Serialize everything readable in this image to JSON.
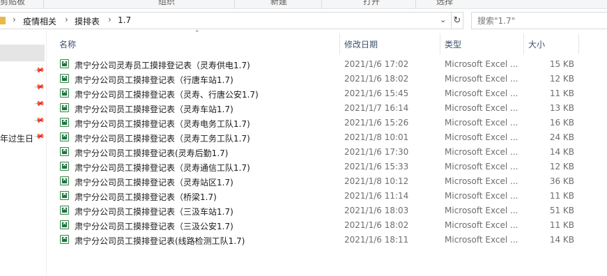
{
  "ribbon": {
    "groups": [
      "剪贴板",
      "组织",
      "新建",
      "打开",
      "选择"
    ]
  },
  "address": {
    "crumbs": [
      "疫情相关",
      "摸排表",
      "1.7"
    ],
    "separator": "›",
    "dropdown_icon": "chevron-down-icon",
    "refresh_icon": "refresh-icon"
  },
  "search": {
    "placeholder": "搜索\"1.7\""
  },
  "nav": {
    "partial_item": "年过生日"
  },
  "columns": {
    "name": "名称",
    "date": "修改日期",
    "type": "类型",
    "size": "大小"
  },
  "files": [
    {
      "name": "肃宁分公司灵寿员工摸排登记表（灵寿供电1.7)",
      "date": "2021/1/6 17:02",
      "type": "Microsoft Excel ...",
      "size": "15 KB"
    },
    {
      "name": "肃宁分公司员工摸排登记表（行唐车站1.7)",
      "date": "2021/1/6 18:02",
      "type": "Microsoft Excel ...",
      "size": "12 KB"
    },
    {
      "name": "肃宁分公司员工摸排登记表（灵寿、行唐公安1.7)",
      "date": "2021/1/6 15:45",
      "type": "Microsoft Excel ...",
      "size": "11 KB"
    },
    {
      "name": "肃宁分公司员工摸排登记表（灵寿车站1.7)",
      "date": "2021/1/7 16:14",
      "type": "Microsoft Excel ...",
      "size": "13 KB"
    },
    {
      "name": "肃宁分公司员工摸排登记表（灵寿电务工队1.7)",
      "date": "2021/1/6 15:26",
      "type": "Microsoft Excel ...",
      "size": "16 KB"
    },
    {
      "name": "肃宁分公司员工摸排登记表（灵寿工务工队1.7)",
      "date": "2021/1/8 10:01",
      "type": "Microsoft Excel ...",
      "size": "24 KB"
    },
    {
      "name": "肃宁分公司员工摸排登记表(灵寿后勤1.7)",
      "date": "2021/1/6 17:30",
      "type": "Microsoft Excel ...",
      "size": "14 KB"
    },
    {
      "name": "肃宁分公司员工摸排登记表（灵寿通信工队1.7)",
      "date": "2021/1/6 15:33",
      "type": "Microsoft Excel ...",
      "size": "12 KB"
    },
    {
      "name": "肃宁分公司员工摸排登记表（灵寿站区1.7)",
      "date": "2021/1/8 10:12",
      "type": "Microsoft Excel ...",
      "size": "36 KB"
    },
    {
      "name": "肃宁分公司员工摸排登记表（桥梁1.7)",
      "date": "2021/1/6 11:14",
      "type": "Microsoft Excel ...",
      "size": "11 KB"
    },
    {
      "name": "肃宁分公司员工摸排登记表（三汲车站1.7)",
      "date": "2021/1/6 18:03",
      "type": "Microsoft Excel ...",
      "size": "51 KB"
    },
    {
      "name": "肃宁分公司员工摸排登记表（三汲公安1.7)",
      "date": "2021/1/6 18:02",
      "type": "Microsoft Excel ...",
      "size": "11 KB"
    },
    {
      "name": "肃宁分公司员工摸排登记表(线路检测工队1.7)",
      "date": "2021/1/6 18:11",
      "type": "Microsoft Excel ...",
      "size": "14 KB"
    }
  ]
}
